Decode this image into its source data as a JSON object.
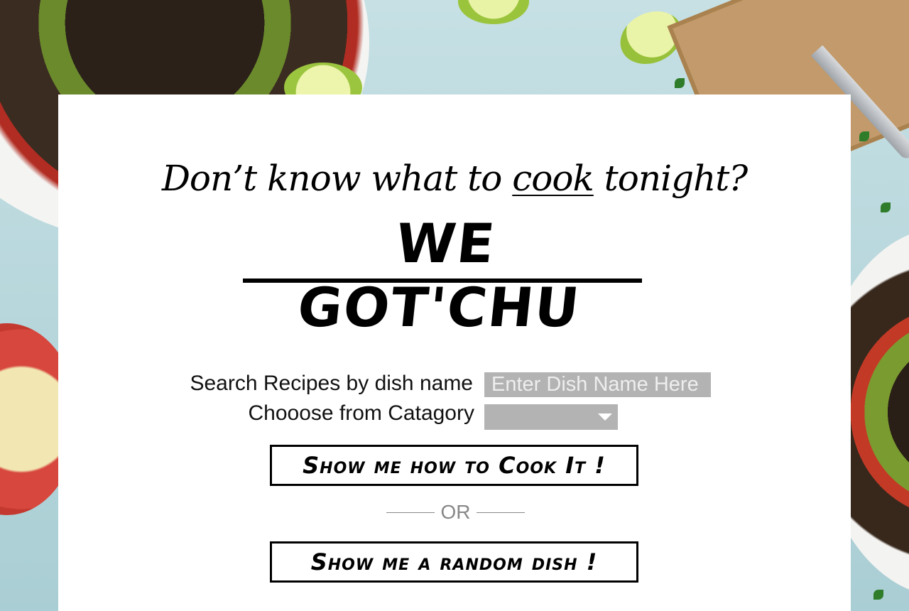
{
  "hero": {
    "tagline_prefix": "Don’t know what to ",
    "tagline_emphasis": "cook",
    "tagline_suffix": " tonight?",
    "headline": "WE GOT'CHU"
  },
  "search": {
    "label": "Search Recipes by dish name",
    "placeholder": "Enter Dish Name Here",
    "value": ""
  },
  "category": {
    "label": "Chooose from Catagory",
    "selected": ""
  },
  "actions": {
    "cook_button": "Show me how to Cook It !",
    "divider": "OR",
    "random_button": "Show me a random dish !"
  },
  "colors": {
    "card_background": "#ffffff",
    "input_background": "#b3b3b3",
    "divider_color": "#888888",
    "text": "#000000"
  }
}
